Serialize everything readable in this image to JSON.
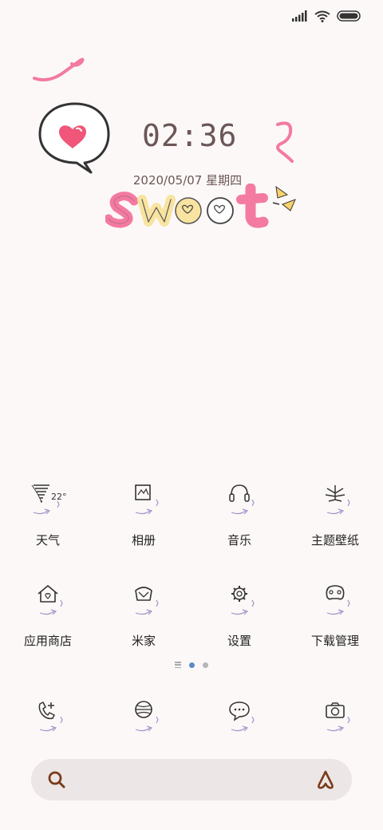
{
  "status_bar": {
    "icons": [
      "signal-icon",
      "wifi-icon",
      "battery-icon"
    ]
  },
  "widget": {
    "time": "02:36",
    "date": "2020/05/07 星期四",
    "word": "sweet"
  },
  "apps_row1": [
    {
      "label": "天气",
      "icon": "weather-icon",
      "temp": "22°"
    },
    {
      "label": "相册",
      "icon": "gallery-icon"
    },
    {
      "label": "音乐",
      "icon": "headphones-icon"
    },
    {
      "label": "主题壁纸",
      "icon": "leaf-icon"
    }
  ],
  "apps_row2": [
    {
      "label": "应用商店",
      "icon": "store-house-icon"
    },
    {
      "label": "米家",
      "icon": "mijia-icon"
    },
    {
      "label": "设置",
      "icon": "gear-icon"
    },
    {
      "label": "下载管理",
      "icon": "gamepad-icon"
    }
  ],
  "dock": [
    {
      "icon": "phone-icon"
    },
    {
      "icon": "browser-icon"
    },
    {
      "icon": "messages-icon"
    },
    {
      "icon": "camera-icon"
    }
  ],
  "pager": {
    "pages": 2,
    "active": 0
  },
  "search": {
    "placeholder": "",
    "icon": "search-icon",
    "assistant_icon": "assistant-a-icon"
  },
  "colors": {
    "background": "#fdf8f8",
    "text": "#222222",
    "clock": "#6b5757",
    "pink": "#f37aa0",
    "yellow": "#f8e4a0",
    "accent_blue": "#5a8bc5",
    "search_bg": "#ece6e6",
    "search_icon": "#7a3a1a"
  }
}
